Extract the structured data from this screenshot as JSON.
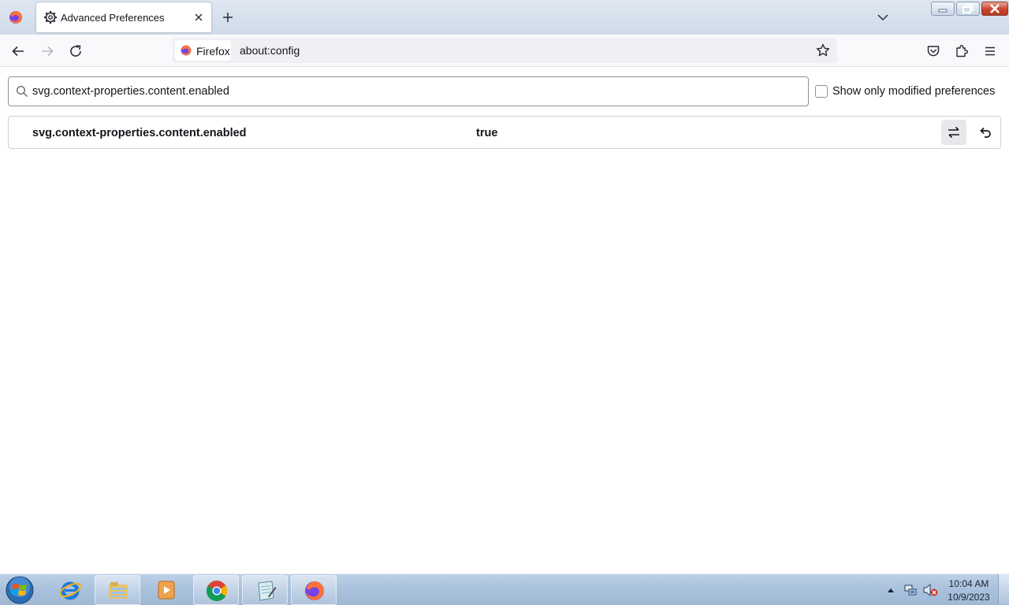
{
  "browser": {
    "tab": {
      "title": "Advanced Preferences"
    },
    "identity_label": "Firefox",
    "url": "about:config"
  },
  "config": {
    "search_value": "svg.context-properties.content.enabled",
    "modified_only_label": "Show only modified preferences",
    "modified_only_checked": false,
    "rows": [
      {
        "name": "svg.context-properties.content.enabled",
        "value": "true"
      }
    ]
  },
  "taskbar": {
    "apps": [
      "internet-explorer",
      "file-explorer",
      "media-player",
      "chrome",
      "notepad",
      "firefox"
    ],
    "clock_time": "10:04 AM",
    "clock_date": "10/9/2023"
  },
  "colors": {
    "accent_firefox_orange": "#ff7139",
    "firefox_purple": "#7542e5",
    "taskbar": "#a9c1dc"
  }
}
